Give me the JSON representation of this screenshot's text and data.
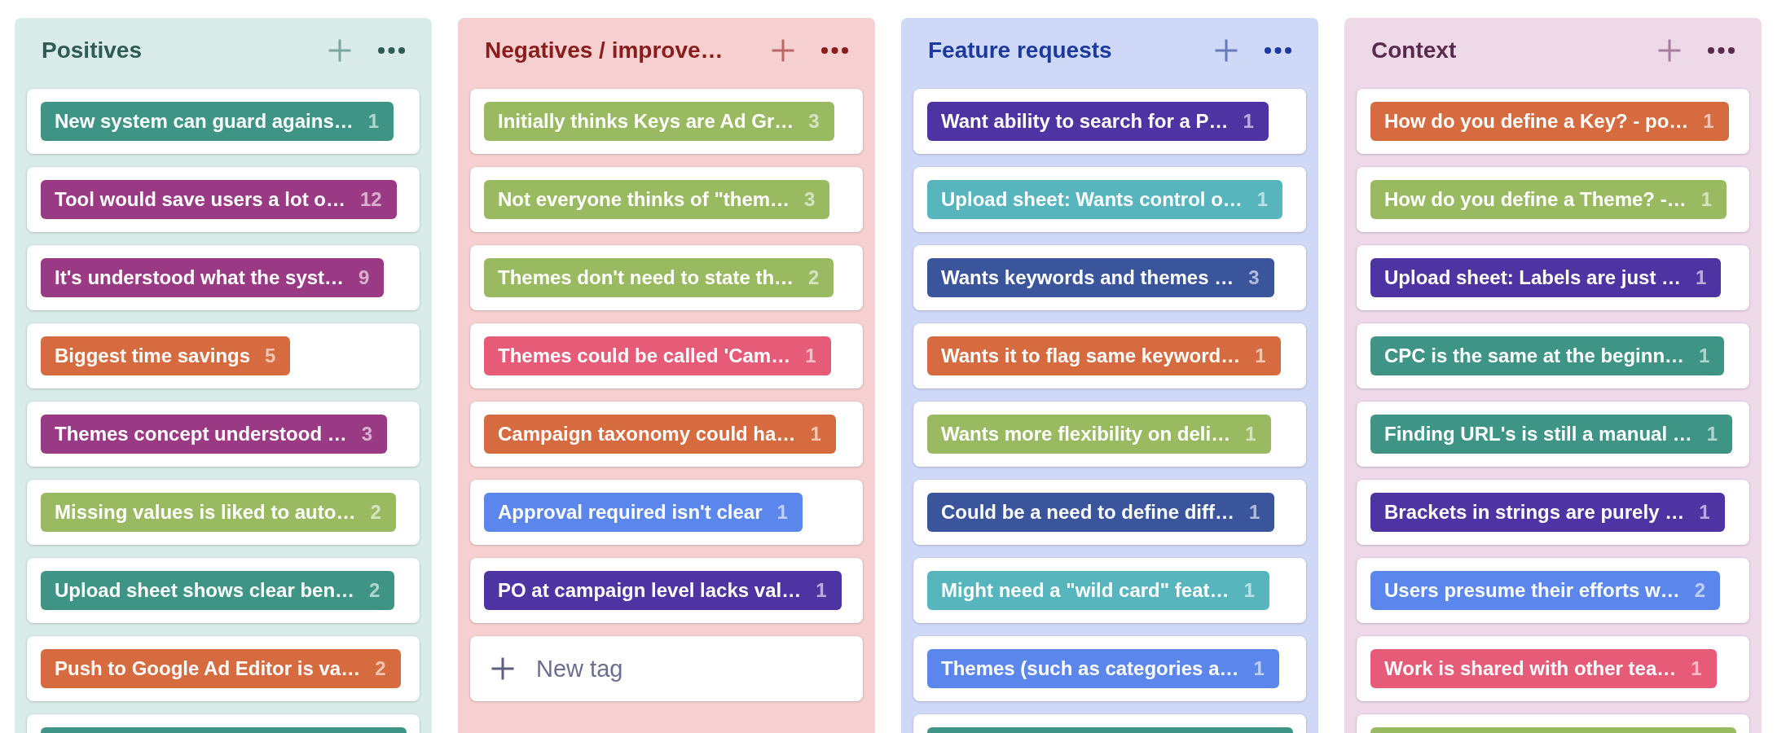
{
  "columns": [
    {
      "title": "Positives",
      "color": "#2e5c55",
      "tags": [
        {
          "label": "New system can guard agains…",
          "count": "1",
          "color": "#3f9585"
        },
        {
          "label": "Tool would save users a lot o…",
          "count": "12",
          "color": "#9b3a84"
        },
        {
          "label": "It's understood what the syst…",
          "count": "9",
          "color": "#9b3a84"
        },
        {
          "label": "Biggest time savings",
          "count": "5",
          "color": "#d66b40"
        },
        {
          "label": "Themes concept understood …",
          "count": "3",
          "color": "#9b3a84"
        },
        {
          "label": "Missing values is liked to auto…",
          "count": "2",
          "color": "#9aba62"
        },
        {
          "label": "Upload sheet shows clear ben…",
          "count": "2",
          "color": "#3f9585"
        },
        {
          "label": "Push to Google Ad Editor is va…",
          "count": "2",
          "color": "#d66b40"
        },
        {
          "color": "#3f9585"
        }
      ]
    },
    {
      "title": "Negatives / improve…",
      "color": "#8a1c1c",
      "tags": [
        {
          "label": "Initially thinks Keys are Ad Gr…",
          "count": "3",
          "color": "#9aba62"
        },
        {
          "label": "Not everyone thinks of \"them…",
          "count": "3",
          "color": "#9aba62"
        },
        {
          "label": "Themes don't need to state th…",
          "count": "2",
          "color": "#9aba62"
        },
        {
          "label": "Themes could be called 'Cam…",
          "count": "1",
          "color": "#e65c78"
        },
        {
          "label": "Campaign taxonomy could ha…",
          "count": "1",
          "color": "#d66b40"
        },
        {
          "label": "Approval required isn't clear",
          "count": "1",
          "color": "#5b86ec"
        },
        {
          "label": "PO at campaign level lacks val…",
          "count": "1",
          "color": "#4e33a2"
        }
      ],
      "new_tag": "New tag"
    },
    {
      "title": "Feature requests",
      "color": "#1c3a9e",
      "tags": [
        {
          "label": "Want ability to search for a P…",
          "count": "1",
          "color": "#4e33a2"
        },
        {
          "label": "Upload sheet: Wants control o…",
          "count": "1",
          "color": "#57b5bd"
        },
        {
          "label": "Wants keywords and themes …",
          "count": "3",
          "color": "#3b559d"
        },
        {
          "label": "Wants it to flag same keyword…",
          "count": "1",
          "color": "#d66b40"
        },
        {
          "label": "Wants more flexibility on deli…",
          "count": "1",
          "color": "#9aba62"
        },
        {
          "label": "Could be a need to define diff…",
          "count": "1",
          "color": "#3b559d"
        },
        {
          "label": "Might need a \"wild card\" feat…",
          "count": "1",
          "color": "#57b5bd"
        },
        {
          "label": "Themes (such as categories a…",
          "count": "1",
          "color": "#5b86ec"
        },
        {
          "color": "#3f9585"
        }
      ]
    },
    {
      "title": "Context",
      "color": "#5a2a4e",
      "tags": [
        {
          "label": "How do you define a Key? - po…",
          "count": "1",
          "color": "#d66b40"
        },
        {
          "label": "How do you define a Theme? -…",
          "count": "1",
          "color": "#9aba62"
        },
        {
          "label": "Upload sheet: Labels are just …",
          "count": "1",
          "color": "#4e33a2"
        },
        {
          "label": "CPC is the same at the beginn…",
          "count": "1",
          "color": "#3f9585"
        },
        {
          "label": "Finding URL's is still a manual …",
          "count": "1",
          "color": "#3f9585"
        },
        {
          "label": "Brackets in strings are purely …",
          "count": "1",
          "color": "#4e33a2"
        },
        {
          "label": "Users presume their efforts w…",
          "count": "2",
          "color": "#5b86ec"
        },
        {
          "label": "Work is shared with other tea…",
          "count": "1",
          "color": "#e65c78"
        },
        {
          "color": "#9aba62"
        }
      ]
    }
  ]
}
